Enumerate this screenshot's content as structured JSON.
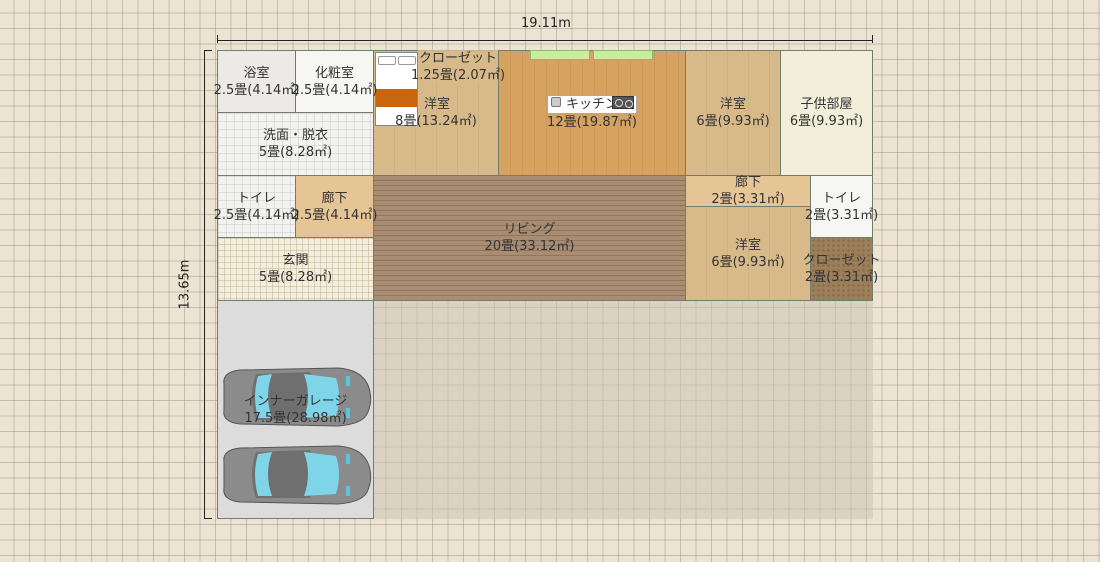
{
  "dimensions": {
    "width_label": "19.11m",
    "height_label": "13.65m"
  },
  "rooms": [
    {
      "name": "浴室",
      "area": "2.5畳(4.14㎡)"
    },
    {
      "name": "化粧室",
      "area": "2.5畳(4.14㎡)"
    },
    {
      "name": "洗面・脱衣",
      "area": "5畳(8.28㎡)"
    },
    {
      "name": "クローゼット",
      "area": "1.25畳(2.07㎡)"
    },
    {
      "name": "洋室",
      "area": "8畳(13.24㎡)"
    },
    {
      "name": "キッチン",
      "area": "12畳(19.87㎡)"
    },
    {
      "name": "洋室",
      "area": "6畳(9.93㎡)"
    },
    {
      "name": "子供部屋",
      "area": "6畳(9.93㎡)"
    },
    {
      "name": "トイレ",
      "area": "2.5畳(4.14㎡)"
    },
    {
      "name": "廊下",
      "area": "2.5畳(4.14㎡)"
    },
    {
      "name": "リビング",
      "area": "20畳(33.12㎡)"
    },
    {
      "name": "廊下",
      "area": "2畳(3.31㎡)"
    },
    {
      "name": "トイレ",
      "area": "2畳(3.31㎡)"
    },
    {
      "name": "玄関",
      "area": "5畳(8.28㎡)"
    },
    {
      "name": "洋室",
      "area": "6畳(9.93㎡)"
    },
    {
      "name": "クローゼット",
      "area": "2畳(3.31㎡)"
    },
    {
      "name": "インナーガレージ",
      "area": "17.5畳(28.98㎡)"
    }
  ]
}
